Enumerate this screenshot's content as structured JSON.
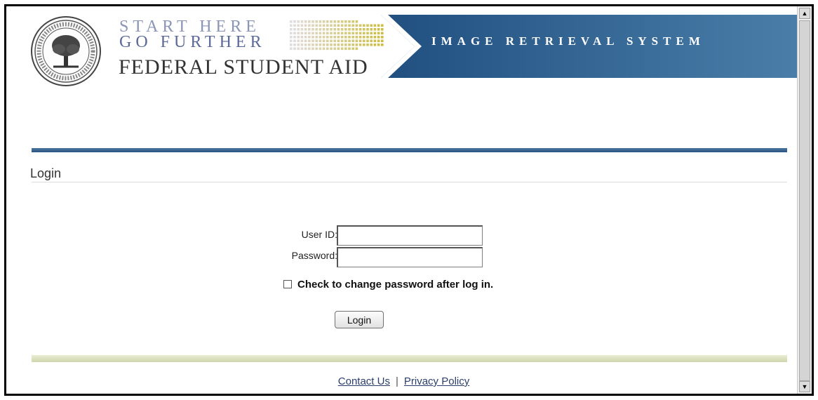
{
  "header": {
    "tagline_line1": "START HERE",
    "tagline_line2": "GO FURTHER",
    "agency_name": "FEDERAL STUDENT AID",
    "system_name": "IMAGE RETRIEVAL SYSTEM",
    "seal_icon": "department-seal-icon",
    "banner_color": "#2f5e8e"
  },
  "page": {
    "title": "Login"
  },
  "form": {
    "userid_label": "User ID:",
    "userid_value": "",
    "password_label": "Password:",
    "password_value": "",
    "change_password_checkbox_label": "Check to change password after log in.",
    "change_password_checked": false,
    "login_button_label": "Login"
  },
  "footer": {
    "contact_link": "Contact Us",
    "separator": "|",
    "privacy_link": "Privacy Policy"
  },
  "colors": {
    "top_rule": "#2f5e8e",
    "bottom_rule": "#d8ddb8",
    "link": "#2b3f6b"
  }
}
